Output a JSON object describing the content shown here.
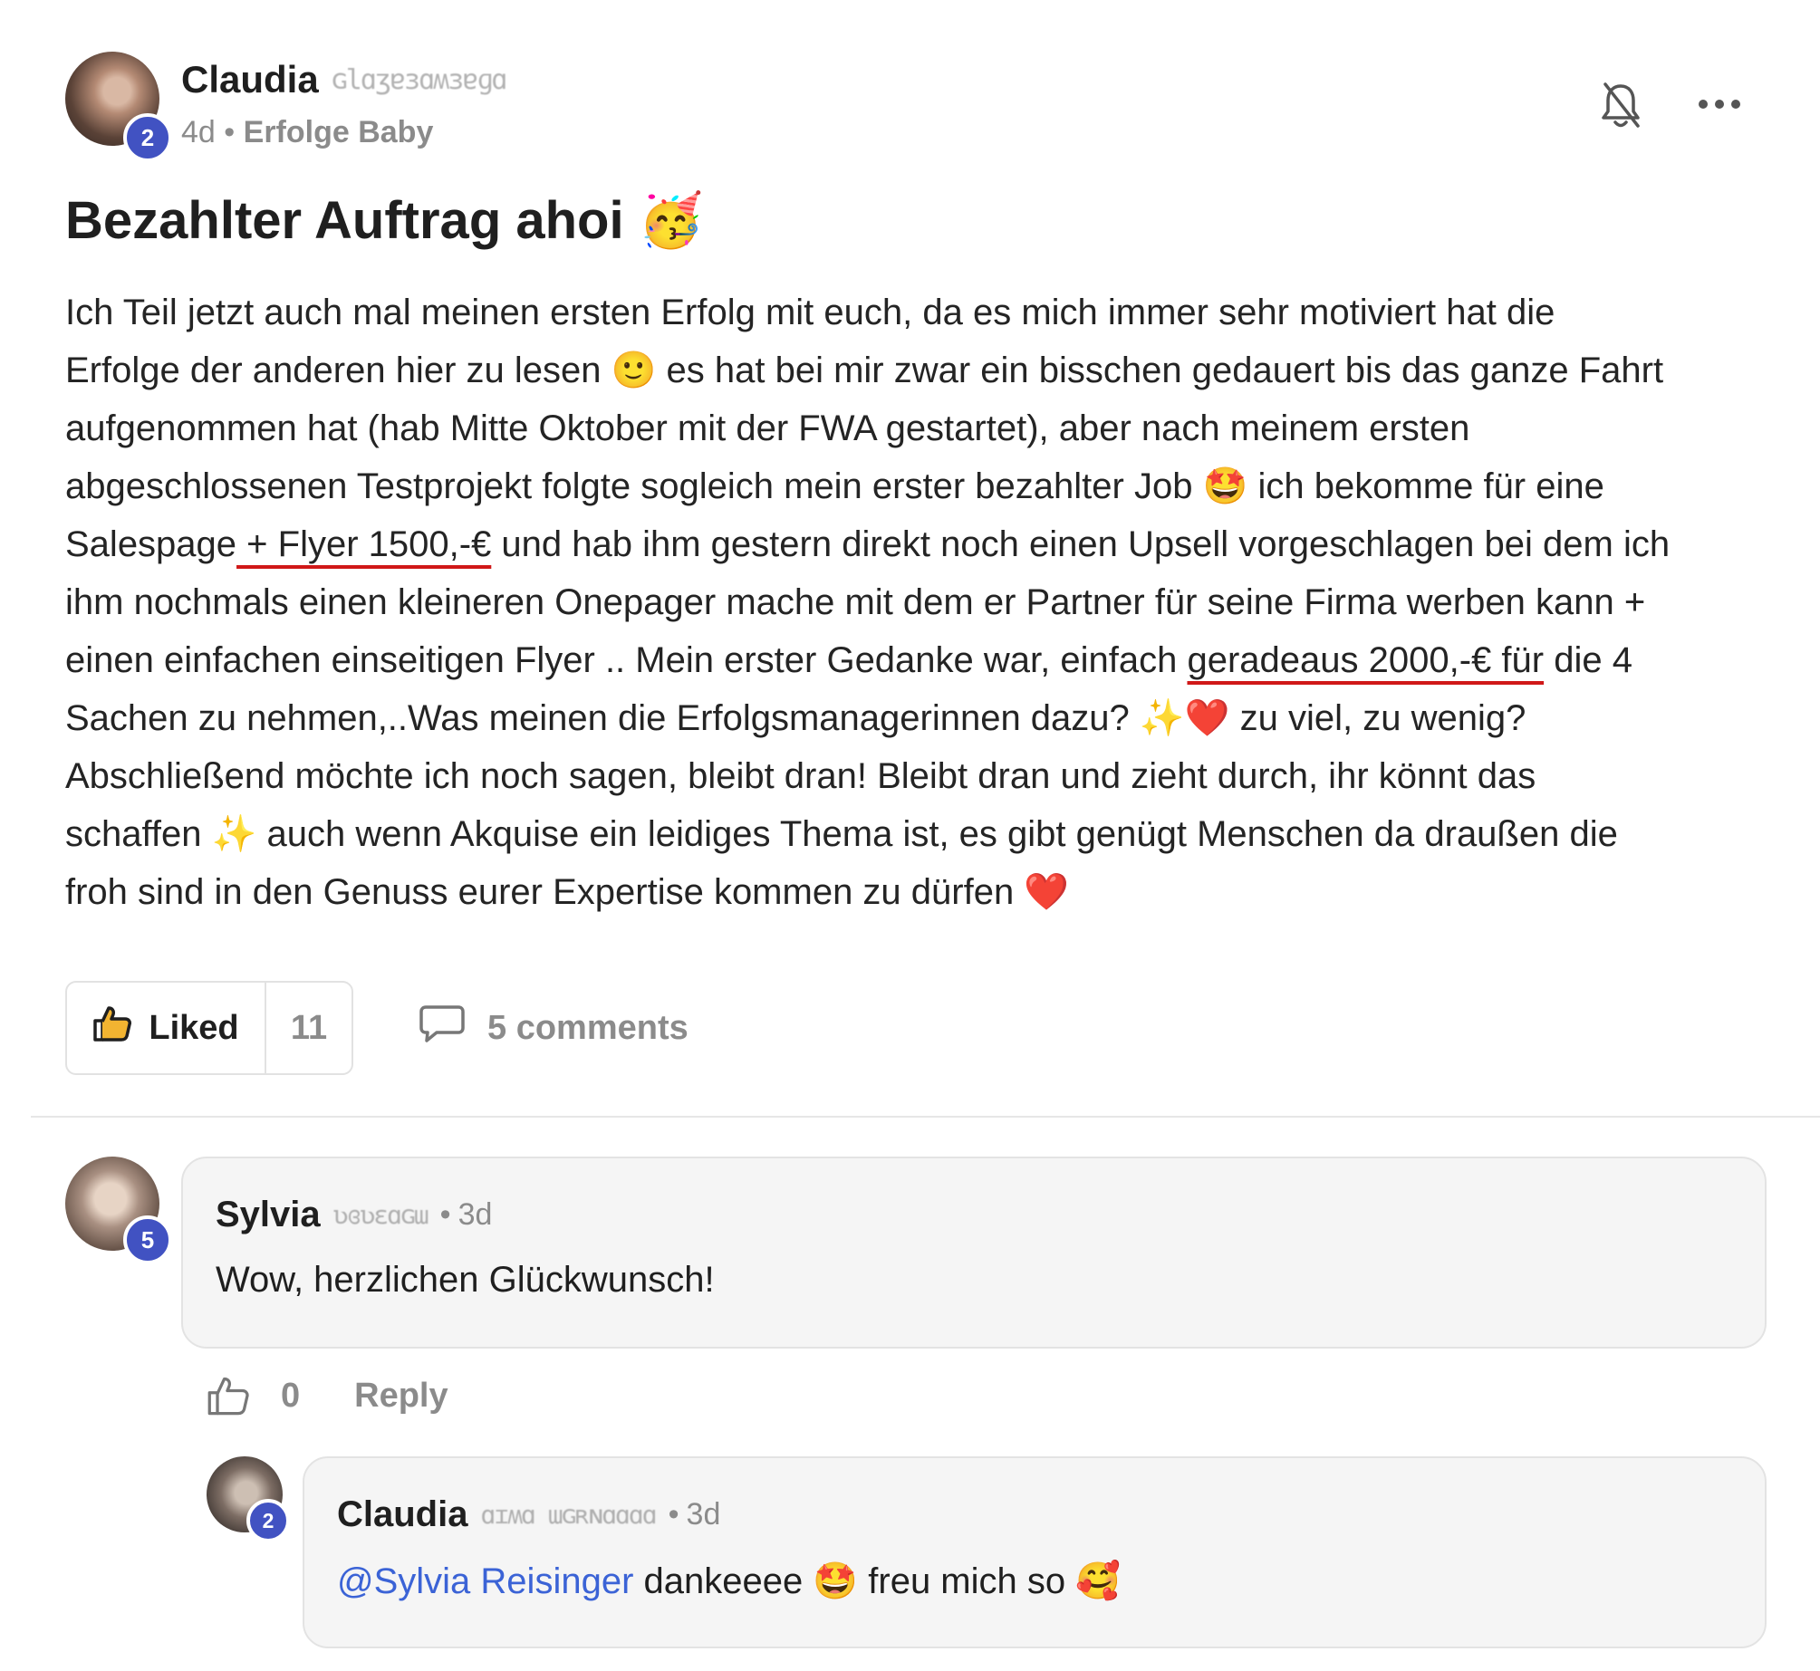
{
  "post": {
    "author": "Claudia",
    "author_level": "2",
    "time": "4d",
    "separator": "•",
    "category": "Erfolge Baby",
    "title": "Bezahlter Auftrag ahoi 🥳",
    "body_lines": [
      "Ich Teil jetzt auch mal meinen ersten Erfolg mit euch, da es mich immer sehr motiviert hat die",
      "Erfolge der anderen hier zu lesen 🙂 es hat bei mir zwar ein bisschen gedauert bis das ganze Fahrt",
      "aufgenommen hat (hab Mitte Oktober mit der FWA gestartet), aber nach meinem ersten",
      "abgeschlossenen Testprojekt folgte sogleich mein erster bezahlter Job 🤩 ich bekomme für eine"
    ],
    "line5": {
      "pre": "Salespage",
      "hl": " + Flyer 1500,-€",
      "post": " und hab ihm gestern direkt noch einen Upsell vorgeschlagen bei dem ich"
    },
    "line6": "ihm nochmals einen kleineren Onepager mache mit dem er Partner für seine Firma werben kann +",
    "line7": {
      "pre": "einen einfachen einseitigen Flyer .. Mein erster Gedanke war, einfach ",
      "hl": "geradeaus 2000,-€ für",
      "post": " die 4"
    },
    "body_lines_end": [
      "Sachen zu nehmen,..Was meinen die Erfolgsmanagerinnen dazu? ✨❤️ zu viel, zu wenig?",
      "Abschließend möchte ich noch sagen, bleibt dran! Bleibt dran und zieht durch, ihr könnt das",
      "schaffen ✨ auch wenn Akquise ein leidiges Thema ist, es gibt genügt Menschen da draußen die",
      "froh sind in den Genuss eurer Expertise kommen zu dürfen ❤️"
    ],
    "like_label": "Liked",
    "like_count": "11",
    "comments_label": "5 comments"
  },
  "icons": {
    "bell_off": "bell-off-icon",
    "more": "more-icon",
    "like": "thumbs-up-icon",
    "comment": "comment-icon"
  },
  "comments": [
    {
      "author": "Sylvia",
      "level": "5",
      "time": "3d",
      "separator": "•",
      "text": "Wow, herzlichen Glückwunsch!",
      "likes": "0",
      "reply_label": "Reply"
    },
    {
      "author": "Claudia",
      "level": "2",
      "time": "3d",
      "separator": "•",
      "mention": "@Sylvia Reisinger",
      "text": " dankeeee 🤩 freu mich so 🥰"
    }
  ],
  "colors": {
    "accent": "#4152c2",
    "mention": "#3b63d6",
    "underline": "#d01818"
  }
}
